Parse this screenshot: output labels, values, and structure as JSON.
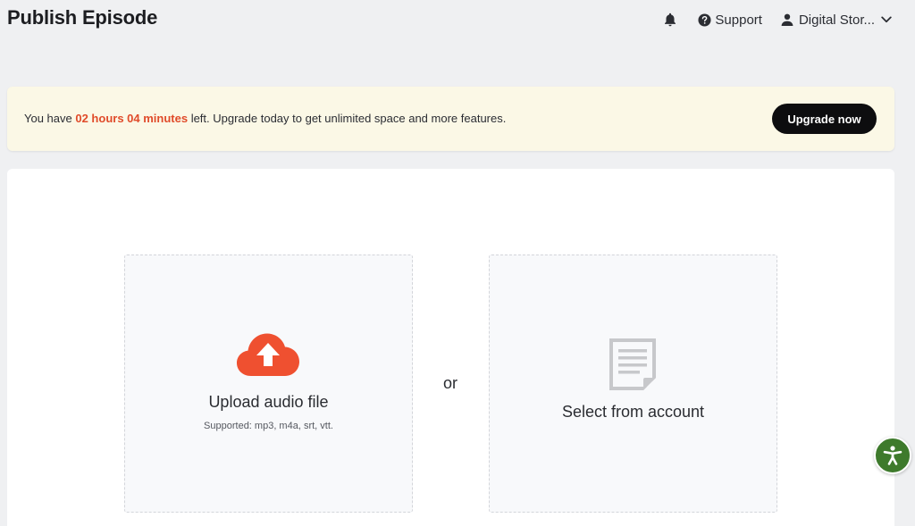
{
  "header": {
    "title": "Publish Episode",
    "support_label": "Support",
    "account_label": "Digital Stor...",
    "icons": {
      "bell": "bell-icon",
      "support": "question-circle-icon",
      "account": "user-icon",
      "chevron": "chevron-down-icon"
    }
  },
  "banner": {
    "prefix": "You have ",
    "time_left": "02 hours 04 minutes",
    "suffix": " left. Upgrade today to get unlimited space and more features.",
    "button_label": "Upgrade now",
    "background_color": "#fbf8e6",
    "highlight_color": "#e04b2a"
  },
  "upload": {
    "title": "Upload audio file",
    "supported": "Supported: mp3, m4a, srt, vtt.",
    "icon": "cloud-upload-icon",
    "icon_color": "#ef5030"
  },
  "separator": {
    "text": "or"
  },
  "select": {
    "title": "Select from account",
    "icon": "document-icon",
    "icon_color": "#c7c8cb"
  },
  "accessibility": {
    "icon": "accessibility-icon",
    "color": "#3e7a2c"
  }
}
